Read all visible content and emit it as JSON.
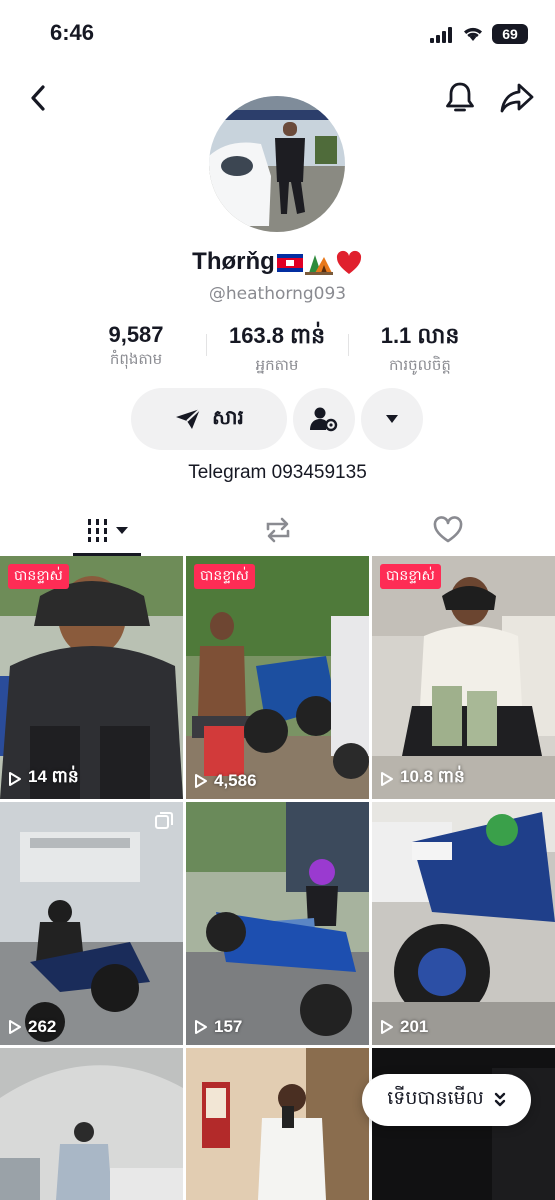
{
  "status": {
    "time": "6:46",
    "battery": "69"
  },
  "profile": {
    "display_name": "Thørňg",
    "handle": "@heathorng093",
    "bio": "Telegram 093459135"
  },
  "stats": [
    {
      "value": "9,587",
      "label": "កំពុងតាម"
    },
    {
      "value": "163.8 ពាន់",
      "label": "អ្នកតាម"
    },
    {
      "value": "1.1 លាន",
      "label": "ការចូលចិត្ត"
    }
  ],
  "actions": {
    "message_label": "សារ"
  },
  "grid": [
    {
      "pinned": "បានខ្ទាស់",
      "views": "14 ពាន់"
    },
    {
      "pinned": "បានខ្ទាស់",
      "views": "4,586"
    },
    {
      "pinned": "បានខ្ទាស់",
      "views": "10.8 ពាន់"
    },
    {
      "pinned": "",
      "views": "262"
    },
    {
      "pinned": "",
      "views": "157"
    },
    {
      "pinned": "",
      "views": "201"
    },
    {
      "pinned": "",
      "views": ""
    },
    {
      "pinned": "",
      "views": ""
    },
    {
      "pinned": "",
      "views": ""
    }
  ],
  "recent_pill": {
    "label": "ទើបបានមើល"
  },
  "icons": {
    "back": "chevron-left-icon",
    "bell": "bell-icon",
    "share": "share-icon",
    "send": "send-icon",
    "add_friend": "user-gear-icon",
    "dropdown": "caret-down-icon",
    "videos_tab": "grid-icon",
    "reposts_tab": "repost-icon",
    "liked_tab": "heart-icon"
  },
  "colors": {
    "accent": "#fe2c55",
    "text": "#161823",
    "secondary": "#8a8b91",
    "button_bg": "#f1f1f2"
  }
}
